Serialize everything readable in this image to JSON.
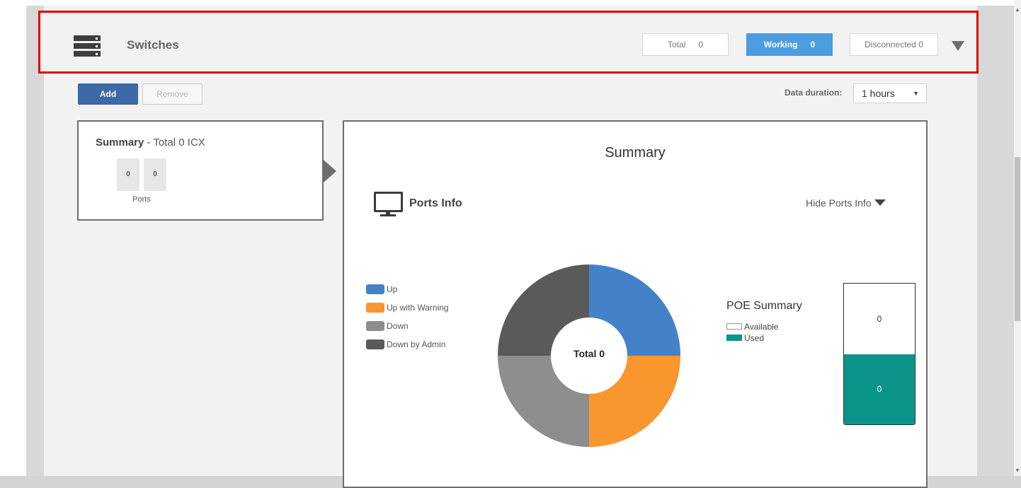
{
  "header": {
    "title": "Switches",
    "total_label": "Total",
    "total_value": "0",
    "working_label": "Working",
    "working_value": "0",
    "disconnected_label": "Disconnected",
    "disconnected_value": "0",
    "icon": "switch-stack-icon",
    "expand_icon": "triangle-down-icon"
  },
  "toolbar": {
    "add_label": "Add",
    "remove_label": "Remove",
    "duration_label": "Data duration:",
    "duration_value": "1 hours",
    "duration_caret": "▼"
  },
  "summary_card": {
    "title_bold": "Summary",
    "title_rest": " - Total 0 ICX",
    "ports": [
      "0",
      "0"
    ],
    "ports_label": "Ports"
  },
  "main_panel": {
    "title": "Summary",
    "ports_info_title": "Ports Info",
    "ports_info_icon": "monitor-icon",
    "hide_label": "Hide Ports Info",
    "legend": [
      {
        "label": "Up",
        "color": "#4382c8"
      },
      {
        "label": "Up with Warning",
        "color": "#f9962e"
      },
      {
        "label": "Down",
        "color": "#8e8e8e"
      },
      {
        "label": "Down by Admin",
        "color": "#5a5a5a"
      }
    ],
    "donut_center": "Total 0",
    "poe": {
      "title": "POE Summary",
      "available_label": "Available",
      "used_label": "Used",
      "available_value": "0",
      "used_value": "0",
      "used_color": "#0a948a"
    }
  },
  "chart_data": {
    "type": "pie",
    "title": "",
    "categories": [
      "Up",
      "Up with Warning",
      "Down",
      "Down by Admin"
    ],
    "values": [
      0,
      0,
      0,
      0
    ],
    "colors": [
      "#4382c8",
      "#f9962e",
      "#8e8e8e",
      "#5a5a5a"
    ],
    "center_label": "Total 0",
    "note_display": "equal quarter segments shown as placeholder for zero totals"
  }
}
